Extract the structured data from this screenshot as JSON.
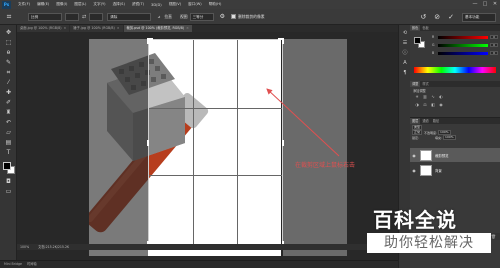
{
  "app": {
    "logo": "Ps"
  },
  "menu": [
    "文件(F)",
    "编辑(E)",
    "图像(I)",
    "图层(L)",
    "文字(Y)",
    "选择(S)",
    "滤镜(T)",
    "3D(D)",
    "视图(V)",
    "窗口(W)",
    "帮助(H)"
  ],
  "window_controls": [
    "—",
    "□",
    "✕"
  ],
  "options_bar": {
    "ratio_select": "比例",
    "width_value": "",
    "height_value": "",
    "resolution_select": "清除",
    "straighten_label": "拉直",
    "view_label": "视图",
    "view_select": "三等分",
    "delete_pixels_label": "删除裁剪的像素",
    "workspace_select": "基本功能"
  },
  "tabs": [
    {
      "label": "桌面.jpg @ 100% (RGB/8)",
      "active": false
    },
    {
      "label": "锤子.jpg @ 100% (RGB/8)",
      "active": false
    },
    {
      "label": "裁剪.psd @ 100% (裁剪预览, RGB/8)",
      "active": true
    }
  ],
  "status": {
    "zoom": "100%",
    "doc_info": "文档:215.2K/215.2K"
  },
  "bottom_tabs": [
    "Mini Bridge",
    "时间轴"
  ],
  "panels": {
    "color_tabs": [
      "颜色",
      "色板"
    ],
    "sliders": [
      {
        "label": "R",
        "value": "0",
        "color": "#d03030"
      },
      {
        "label": "G",
        "value": "0",
        "color": "#30b030"
      },
      {
        "label": "B",
        "value": "0",
        "color": "#3050d0"
      }
    ],
    "adj_tabs": [
      "调整",
      "样式"
    ],
    "adj_title": "添加调整",
    "layer_tabs": [
      "图层",
      "通道",
      "路径"
    ],
    "kind_select": "类型",
    "blend_select": "正常",
    "opacity_label": "不透明度:",
    "opacity_value": "100%",
    "lock_label": "锁定:",
    "fill_label": "填充:",
    "fill_value": "100%",
    "layers": [
      {
        "name": "裁剪预览",
        "selected": true
      },
      {
        "name": "背景",
        "selected": false
      }
    ]
  },
  "annotation": {
    "text": "在裁剪区域上鼠标右击",
    "color": "#e05050"
  },
  "watermark": {
    "title": "百科全说",
    "subtitle": "助你轻松解决"
  }
}
